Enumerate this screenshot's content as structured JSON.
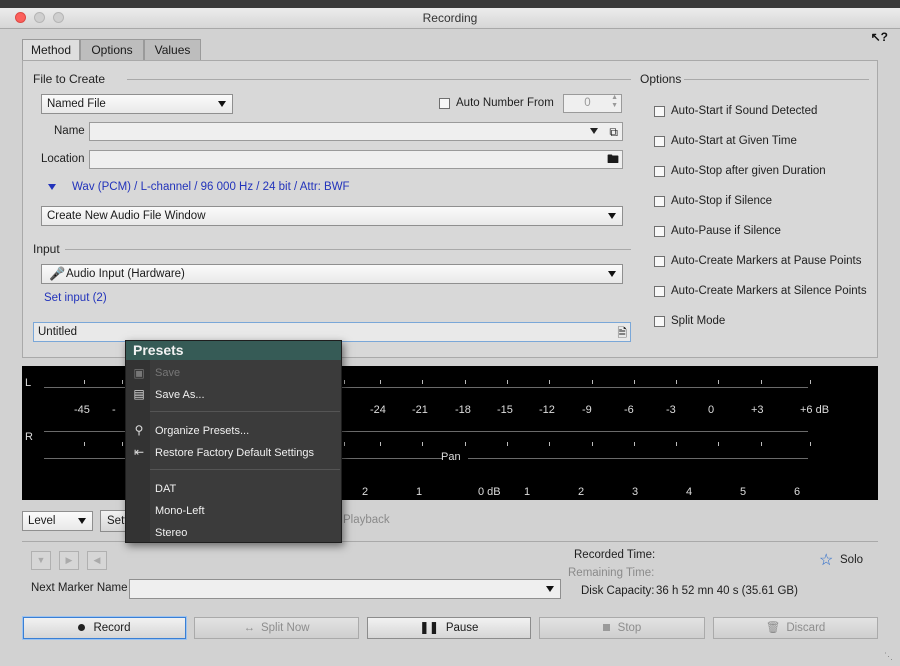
{
  "window": {
    "title": "Recording"
  },
  "tabs": [
    "Method",
    "Options",
    "Values"
  ],
  "file_to_create": {
    "section_label": "File to Create",
    "type_value": "Named File",
    "auto_number_label": "Auto Number From",
    "auto_number_value": "0",
    "name_label": "Name",
    "name_value": "",
    "location_label": "Location",
    "location_value": "",
    "format_text": "Wav (PCM) / L-channel / 96 000 Hz / 24 bit / Attr: BWF",
    "window_option": "Create New Audio File Window"
  },
  "input": {
    "section_label": "Input",
    "device": "Audio Input (Hardware)",
    "set_input_link": "Set input (2)"
  },
  "preset_field": {
    "value": "Untitled"
  },
  "options": {
    "section_label": "Options",
    "items": [
      "Auto-Start if Sound Detected",
      "Auto-Start at Given Time",
      "Auto-Stop after given Duration",
      "Auto-Stop if Silence",
      "Auto-Pause if Silence",
      "Auto-Create Markers at Pause Points",
      "Auto-Create Markers at Silence Points",
      "Split Mode"
    ]
  },
  "meter": {
    "channel_left": "L",
    "channel_right": "R",
    "db_scale": [
      "-45",
      "-",
      "7",
      "-24",
      "-21",
      "-18",
      "-15",
      "-12",
      "-9",
      "-6",
      "-3",
      "0",
      "+3",
      "+6 dB"
    ],
    "pan_label": "Pan",
    "pan_scale": [
      "2",
      "1",
      "0 dB",
      "1",
      "2",
      "3",
      "4",
      "5",
      "6"
    ]
  },
  "below_meter": {
    "mode_value": "Level",
    "settings_label": "Sett",
    "playback_label": "Playback"
  },
  "status": {
    "recorded_time_label": "Recorded Time:",
    "remaining_time_label": "Remaining Time:",
    "disk_capacity_label": "Disk Capacity:",
    "disk_capacity_value": "36 h 52 mn 40 s (35.61 GB)",
    "solo_label": "Solo",
    "next_marker_label": "Next Marker Name",
    "next_marker_value": ""
  },
  "buttons": {
    "record": "Record",
    "split_now": "Split Now",
    "pause": "Pause",
    "stop": "Stop",
    "discard": "Discard"
  },
  "presets_menu": {
    "title": "Presets",
    "save": "Save",
    "save_as": "Save As...",
    "organize": "Organize Presets...",
    "restore": "Restore Factory Default Settings",
    "items": [
      "DAT",
      "Mono-Left",
      "Stereo"
    ]
  }
}
